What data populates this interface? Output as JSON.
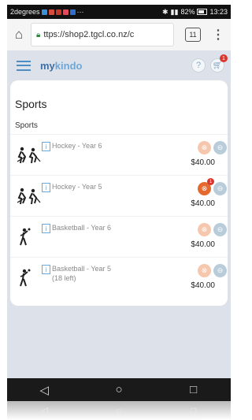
{
  "status_bar": {
    "carrier": "2degrees",
    "battery": "82%",
    "time": "13:23"
  },
  "browser": {
    "url": "ttps://shop2.tgcl.co.nz/c",
    "tab_count": "11"
  },
  "app": {
    "logo_my": "my",
    "logo_kindo": "kindo",
    "cart_count": "1"
  },
  "page": {
    "title": "Sports",
    "section": "Sports",
    "items": [
      {
        "name": "Hockey - Year 6",
        "sub": "",
        "price": "$40.00",
        "sport": "hockey",
        "in_cart": false
      },
      {
        "name": "Hockey - Year 5",
        "sub": "",
        "price": "$40.00",
        "sport": "hockey",
        "in_cart": true,
        "cart_badge": "1"
      },
      {
        "name": "Basketball - Year 6",
        "sub": "",
        "price": "$40.00",
        "sport": "basketball",
        "in_cart": false
      },
      {
        "name": "Basketball - Year 5",
        "sub": "(18 left)",
        "price": "$40.00",
        "sport": "basketball",
        "in_cart": false
      }
    ]
  },
  "colors": {
    "accent": "#4c8ec4",
    "cart_active": "#e5692e",
    "badge": "#d9362e"
  }
}
